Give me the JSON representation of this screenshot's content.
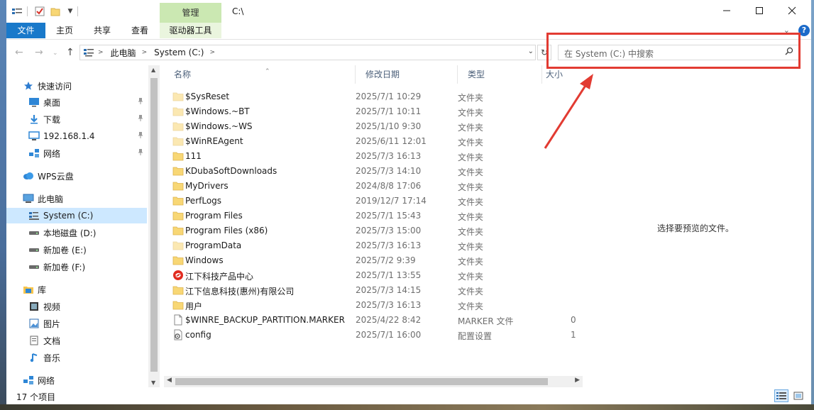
{
  "titlebar": {
    "context_tab": "管理",
    "path": "C:\\",
    "controls": [
      "—",
      "☐",
      "✕"
    ]
  },
  "ribbon": {
    "tabs": [
      "文件",
      "主页",
      "共享",
      "查看",
      "驱动器工具"
    ],
    "accent_color": "#1979ca",
    "context_color": "#cbe8b2"
  },
  "address": {
    "segments": [
      "此电脑",
      "System (C:)"
    ],
    "search_placeholder": "在 System (C:) 中搜索"
  },
  "nav": {
    "items": [
      {
        "label": "快速访问",
        "icon": "star-icon",
        "level": 0,
        "pinned": false
      },
      {
        "label": "桌面",
        "icon": "desktop-icon",
        "level": 1,
        "pinned": true
      },
      {
        "label": "下载",
        "icon": "download-icon",
        "level": 1,
        "pinned": true
      },
      {
        "label": "192.168.1.4",
        "icon": "monitor-icon",
        "level": 1,
        "pinned": true
      },
      {
        "label": "网络",
        "icon": "network-icon",
        "level": 1,
        "pinned": true
      },
      {
        "label": "WPS云盘",
        "icon": "cloud-icon",
        "level": 0,
        "pinned": false
      },
      {
        "label": "此电脑",
        "icon": "computer-icon",
        "level": 0,
        "pinned": false
      },
      {
        "label": "System (C:)",
        "icon": "system-drive-icon",
        "level": 1,
        "pinned": false
      },
      {
        "label": "本地磁盘 (D:)",
        "icon": "drive-icon",
        "level": 1,
        "pinned": false
      },
      {
        "label": "新加卷 (E:)",
        "icon": "drive-icon",
        "level": 1,
        "pinned": false
      },
      {
        "label": "新加卷 (F:)",
        "icon": "drive-icon",
        "level": 1,
        "pinned": false
      },
      {
        "label": "库",
        "icon": "library-icon",
        "level": 0,
        "pinned": false
      },
      {
        "label": "视频",
        "icon": "video-icon",
        "level": 1,
        "pinned": false
      },
      {
        "label": "图片",
        "icon": "pictures-icon",
        "level": 1,
        "pinned": false
      },
      {
        "label": "文档",
        "icon": "documents-icon",
        "level": 1,
        "pinned": false
      },
      {
        "label": "音乐",
        "icon": "music-icon",
        "level": 1,
        "pinned": false
      },
      {
        "label": "网络",
        "icon": "network-icon",
        "level": 0,
        "pinned": false
      }
    ],
    "selected": "System (C:)"
  },
  "columns": [
    "名称",
    "修改日期",
    "类型",
    "大小"
  ],
  "files": [
    {
      "name": "$SysReset",
      "date": "2025/7/1 10:29",
      "type": "文件夹",
      "size": "",
      "icon": "folder-icon",
      "faded": true
    },
    {
      "name": "$Windows.~BT",
      "date": "2025/7/1 10:11",
      "type": "文件夹",
      "size": "",
      "icon": "folder-icon",
      "faded": true
    },
    {
      "name": "$Windows.~WS",
      "date": "2025/1/10 9:30",
      "type": "文件夹",
      "size": "",
      "icon": "folder-icon",
      "faded": true
    },
    {
      "name": "$WinREAgent",
      "date": "2025/6/11 12:01",
      "type": "文件夹",
      "size": "",
      "icon": "folder-icon",
      "faded": true
    },
    {
      "name": "111",
      "date": "2025/7/3 16:13",
      "type": "文件夹",
      "size": "",
      "icon": "folder-icon",
      "faded": false
    },
    {
      "name": "KDubaSoftDownloads",
      "date": "2025/7/3 14:10",
      "type": "文件夹",
      "size": "",
      "icon": "folder-icon",
      "faded": false
    },
    {
      "name": "MyDrivers",
      "date": "2024/8/8 17:06",
      "type": "文件夹",
      "size": "",
      "icon": "folder-icon",
      "faded": false
    },
    {
      "name": "PerfLogs",
      "date": "2019/12/7 17:14",
      "type": "文件夹",
      "size": "",
      "icon": "folder-icon",
      "faded": false
    },
    {
      "name": "Program Files",
      "date": "2025/7/1 15:43",
      "type": "文件夹",
      "size": "",
      "icon": "folder-icon",
      "faded": false
    },
    {
      "name": "Program Files (x86)",
      "date": "2025/7/3 15:00",
      "type": "文件夹",
      "size": "",
      "icon": "folder-icon",
      "faded": false
    },
    {
      "name": "ProgramData",
      "date": "2025/7/3 16:13",
      "type": "文件夹",
      "size": "",
      "icon": "folder-icon",
      "faded": true
    },
    {
      "name": "Windows",
      "date": "2025/7/2 9:39",
      "type": "文件夹",
      "size": "",
      "icon": "folder-icon",
      "faded": false
    },
    {
      "name": "江下科技产品中心",
      "date": "2025/7/1 13:55",
      "type": "文件夹",
      "size": "",
      "icon": "app-folder-icon",
      "faded": false
    },
    {
      "name": "江下信息科技(惠州)有限公司",
      "date": "2025/7/3 14:15",
      "type": "文件夹",
      "size": "",
      "icon": "folder-icon",
      "faded": false
    },
    {
      "name": "用户",
      "date": "2025/7/3 16:13",
      "type": "文件夹",
      "size": "",
      "icon": "folder-icon",
      "faded": false
    },
    {
      "name": "$WINRE_BACKUP_PARTITION.MARKER",
      "date": "2025/4/22 8:42",
      "type": "MARKER 文件",
      "size": "0",
      "icon": "file-icon",
      "faded": false
    },
    {
      "name": "config",
      "date": "2025/7/1 16:00",
      "type": "配置设置",
      "size": "1",
      "icon": "config-file-icon",
      "faded": false
    }
  ],
  "preview": {
    "text": "选择要预览的文件。"
  },
  "status": {
    "count": "17 个项目"
  },
  "annotation": {
    "color": "#e23b32"
  }
}
